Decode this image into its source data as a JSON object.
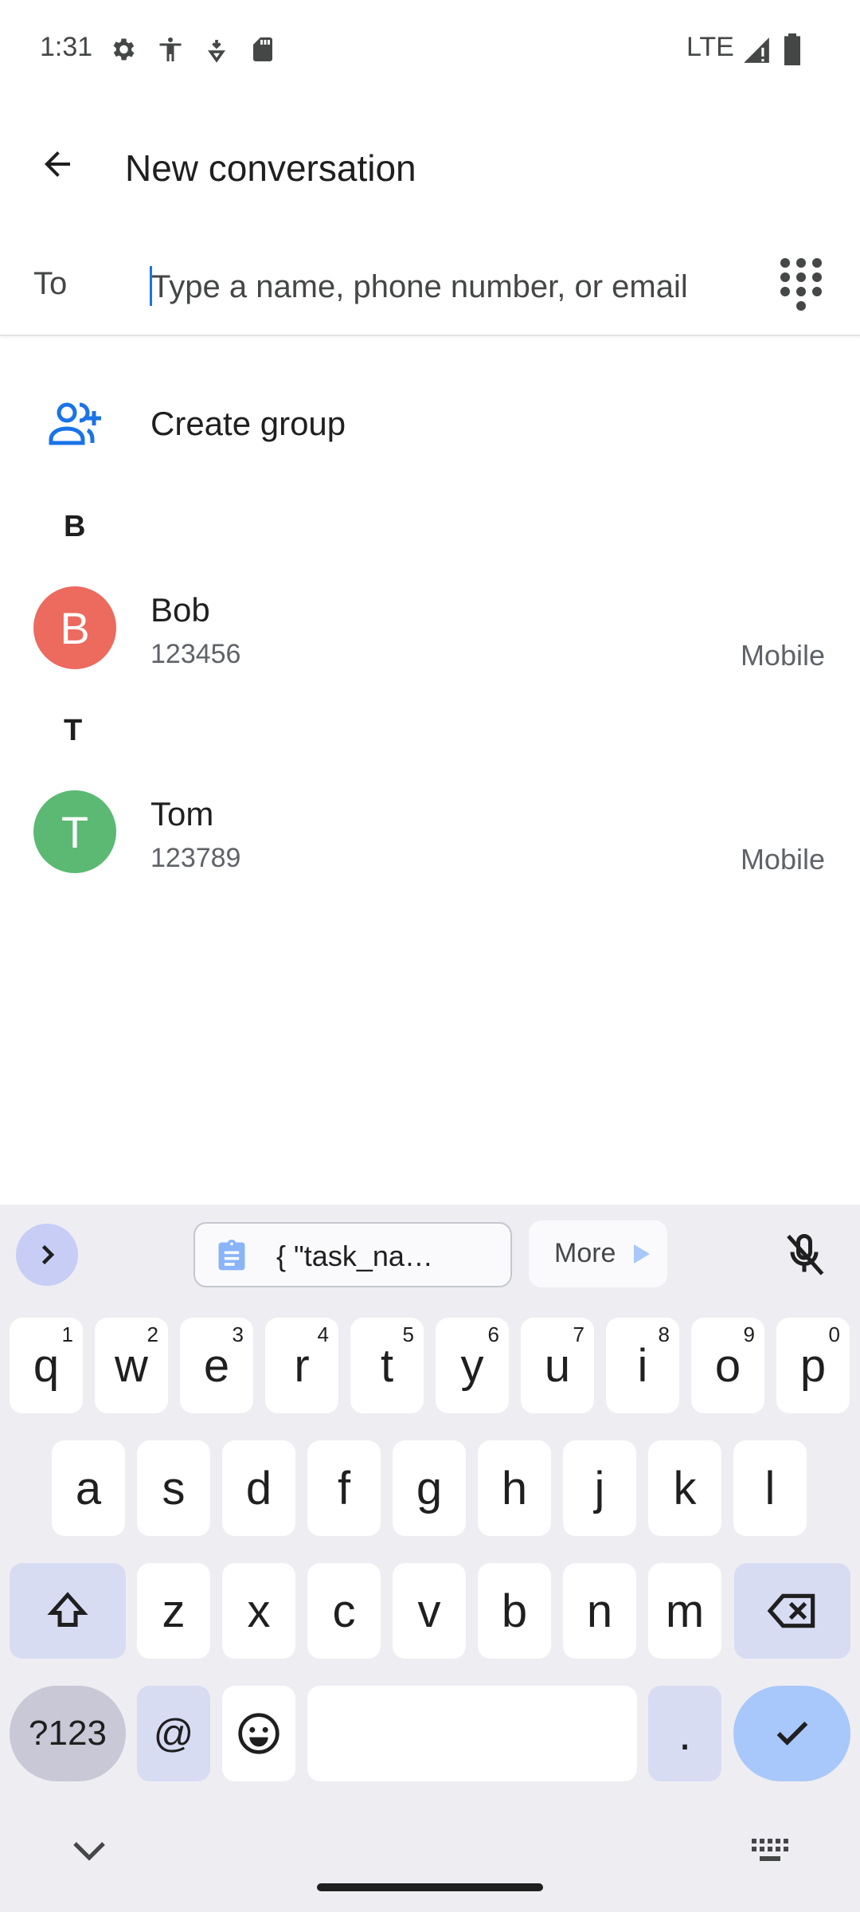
{
  "status_bar": {
    "time": "1:31",
    "network": "LTE",
    "icons": [
      "settings-icon",
      "accessibility-icon",
      "location-icon",
      "sd-card-icon",
      "signal-icon",
      "battery-icon"
    ]
  },
  "app_bar": {
    "title": "New conversation",
    "back_icon": "arrow-back-icon"
  },
  "to_field": {
    "label": "To",
    "placeholder": "Type a name, phone number, or email",
    "value": "",
    "dialpad_icon": "dialpad-icon"
  },
  "create_group": {
    "label": "Create group",
    "icon": "group-add-icon"
  },
  "sections": [
    {
      "letter": "B",
      "contacts": [
        {
          "initial": "B",
          "name": "Bob",
          "number": "123456",
          "type": "Mobile",
          "color": "#ec6a5e"
        }
      ]
    },
    {
      "letter": "T",
      "contacts": [
        {
          "initial": "T",
          "name": "Tom",
          "number": "123789",
          "type": "Mobile",
          "color": "#5bb974"
        }
      ]
    }
  ],
  "keyboard": {
    "clipboard_text": "{     \"task_na…",
    "more_label": "More",
    "rows": [
      [
        {
          "k": "q",
          "h": "1"
        },
        {
          "k": "w",
          "h": "2"
        },
        {
          "k": "e",
          "h": "3"
        },
        {
          "k": "r",
          "h": "4"
        },
        {
          "k": "t",
          "h": "5"
        },
        {
          "k": "y",
          "h": "6"
        },
        {
          "k": "u",
          "h": "7"
        },
        {
          "k": "i",
          "h": "8"
        },
        {
          "k": "o",
          "h": "9"
        },
        {
          "k": "p",
          "h": "0"
        }
      ],
      [
        {
          "k": "a"
        },
        {
          "k": "s"
        },
        {
          "k": "d"
        },
        {
          "k": "f"
        },
        {
          "k": "g"
        },
        {
          "k": "h"
        },
        {
          "k": "j"
        },
        {
          "k": "k"
        },
        {
          "k": "l"
        }
      ],
      [
        {
          "k": "z"
        },
        {
          "k": "x"
        },
        {
          "k": "c"
        },
        {
          "k": "v"
        },
        {
          "k": "b"
        },
        {
          "k": "n"
        },
        {
          "k": "m"
        }
      ]
    ],
    "symbols_label": "?123",
    "at_label": "@",
    "period_label": ".",
    "colors": {
      "background": "#eeedf2",
      "modifier": "#d7dcf3",
      "accent": "#a8c7fa"
    }
  }
}
